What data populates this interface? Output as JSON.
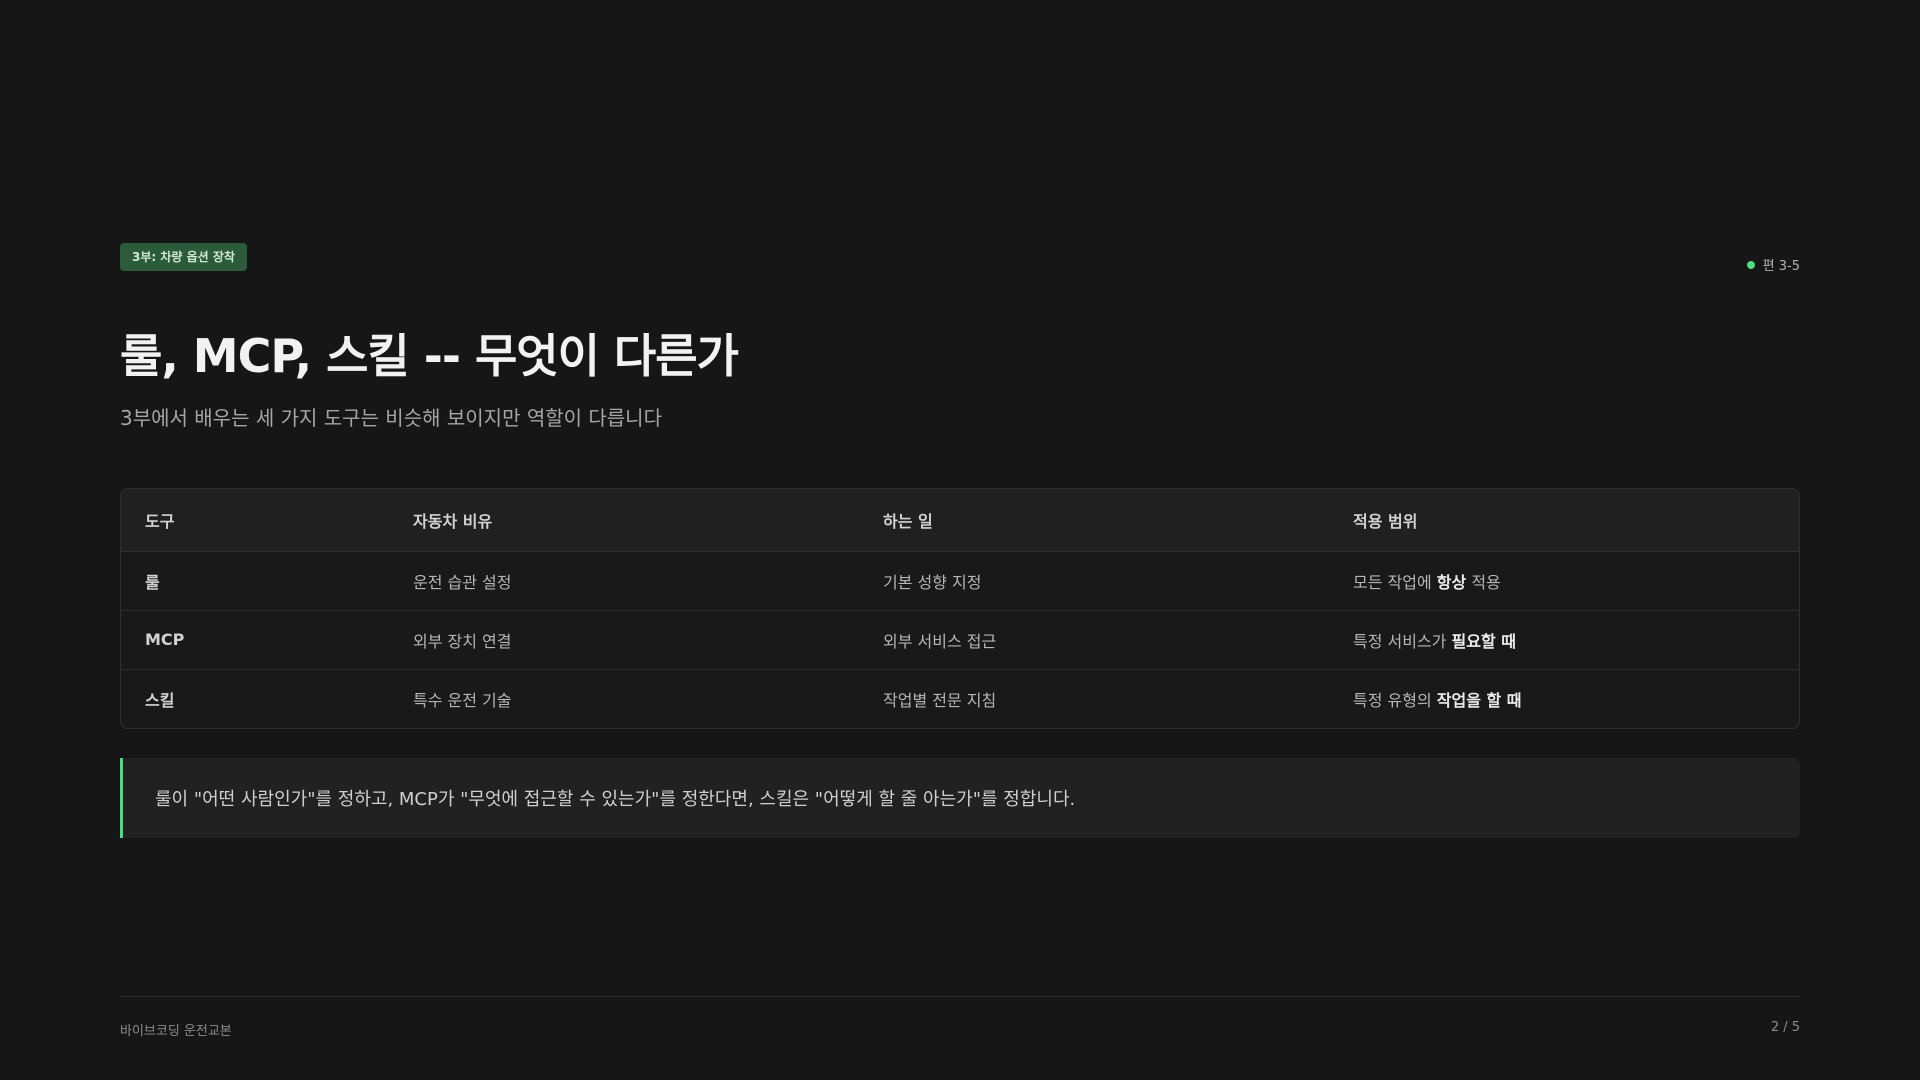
{
  "badge": "3부: 차량 옵션 장착",
  "section_indicator": "편 3-5",
  "title": "룰, MCP, 스킬 -- 무엇이 다른가",
  "subtitle": "3부에서 배우는 세 가지 도구는 비슷해 보이지만 역할이 다릅니다",
  "table": {
    "headers": [
      "도구",
      "자동차 비유",
      "하는 일",
      "적용 범위"
    ],
    "rows": [
      {
        "tool": "룰",
        "analogy": "운전 습관 설정",
        "role": "기본 성향 지정",
        "scope_prefix": "모든 작업에 ",
        "scope_bold": "항상",
        "scope_suffix": " 적용"
      },
      {
        "tool": "MCP",
        "analogy": "외부 장치 연결",
        "role": "외부 서비스 접근",
        "scope_prefix": "특정 서비스가 ",
        "scope_bold": "필요할 때",
        "scope_suffix": ""
      },
      {
        "tool": "스킬",
        "analogy": "특수 운전 기술",
        "role": "작업별 전문 지침",
        "scope_prefix": "특정 유형의 ",
        "scope_bold": "작업을 할 때",
        "scope_suffix": ""
      }
    ]
  },
  "callout": "룰이 \"어떤 사람인가\"를 정하고, MCP가 \"무엇에 접근할 수 있는가\"를 정한다면, 스킬은 \"어떻게 할 줄 아는가\"를 정합니다.",
  "footer": {
    "left": "바이브코딩 운전교본",
    "right": "2 / 5"
  },
  "colors": {
    "background": "#161616",
    "accent": "#4ade80",
    "badge_bg": "#2c5b3a"
  }
}
